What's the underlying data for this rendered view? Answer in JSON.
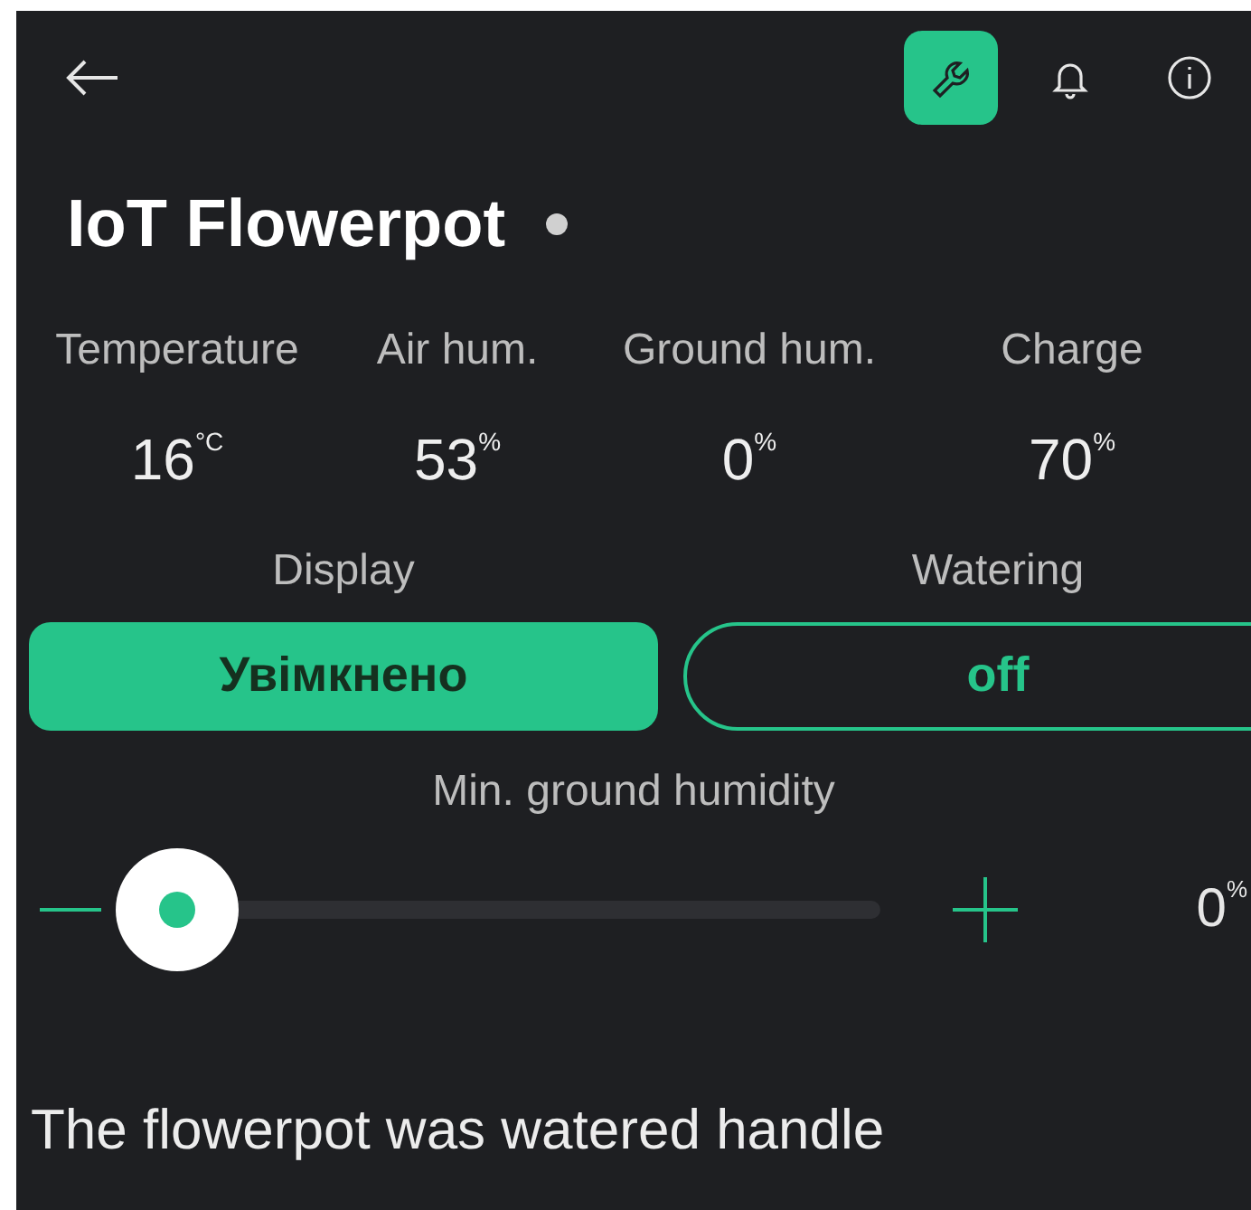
{
  "title": "IoT Flowerpot",
  "toolbar": [
    {
      "kind": "wrench",
      "selected": true
    },
    {
      "kind": "bell",
      "selected": false
    },
    {
      "kind": "info",
      "selected": false
    }
  ],
  "stats": [
    {
      "label": "Temperature",
      "value": "16",
      "unit": "°C"
    },
    {
      "label": "Air hum.",
      "value": "53",
      "unit": "%"
    },
    {
      "label": "Ground hum.",
      "value": "0",
      "unit": "%"
    },
    {
      "label": "Charge",
      "value": "70",
      "unit": "%"
    }
  ],
  "toggles": [
    {
      "label": "Display",
      "button": "Увімкнено",
      "on": true
    },
    {
      "label": "Watering",
      "button": "off",
      "on": false
    }
  ],
  "slider": {
    "label": "Min. ground humidity",
    "value": "0",
    "unit": "%"
  },
  "message": "The flowerpot was watered handle"
}
